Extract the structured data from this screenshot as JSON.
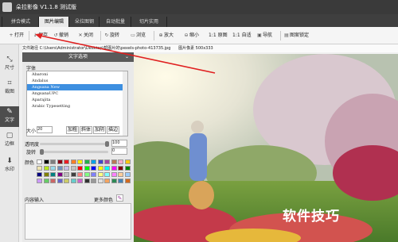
{
  "app": {
    "title": "朵拉影像 V1.1.8 测试版"
  },
  "tabs": [
    {
      "label": "拼合模式"
    },
    {
      "label": "图片编辑"
    },
    {
      "label": "朵拉图钢"
    },
    {
      "label": "自动批量"
    },
    {
      "label": "切片实用"
    }
  ],
  "toolbar": {
    "open": "打开",
    "save": "保存",
    "redo": "撤销",
    "close": "关闭",
    "rotate": "旋转",
    "browse": "浏览",
    "zoom_in": "放大",
    "zoom_out": "缩小",
    "zoom_1to1": "1:1 原图",
    "zoom_fit": "1:1 自适",
    "nav": "导航",
    "fix": "图案锁定"
  },
  "pathbar": {
    "path": "文件路径 C:\\Users\\Administrator\\Desktop\\帮图片的\\pexels-photo-413735.jpg",
    "size": "图片像素 500x333"
  },
  "sidebar": [
    {
      "label": "尺寸",
      "icon": "resize-icon"
    },
    {
      "label": "裁图",
      "icon": "crop-icon"
    },
    {
      "label": "文字",
      "icon": "text-icon"
    },
    {
      "label": "边框",
      "icon": "border-icon"
    },
    {
      "label": "水印",
      "icon": "watermark-icon"
    }
  ],
  "panel": {
    "header": "文字选项",
    "font_label": "字体",
    "fonts": [
      "Abaroni",
      "Andalus",
      "Angsana New",
      "AngsanaUPC",
      "Aparajita",
      "Arabic Typesetting"
    ],
    "selected_font_index": 2,
    "size_label": "大小",
    "size_value": "20",
    "btn_bold": "加粗",
    "btn_italic": "斜体",
    "btn_shadow": "加阴",
    "btn_stroke": "描边",
    "opacity_label": "透明度",
    "opacity_value": "100",
    "rotate_label": "旋转",
    "rotate_value": "0",
    "color_label": "颜色",
    "content_label": "内容输入",
    "more_colors": "更多颜色",
    "accent": "#3d8fe0"
  },
  "swatch_colors": [
    "#ffffff",
    "#000000",
    "#7f7f7f",
    "#880015",
    "#ed1c24",
    "#ff7f27",
    "#fff200",
    "#22b14c",
    "#00a2e8",
    "#3f48cc",
    "#a349a4",
    "#b97a57",
    "#ffaec9",
    "#ffc90e",
    "#efe4b0",
    "#b5e61d",
    "#99d9ea",
    "#7092be",
    "#c8bfe7",
    "#c3c3c3",
    "#ff0000",
    "#00ff00",
    "#0000ff",
    "#ffff00",
    "#00ffff",
    "#ff00ff",
    "#800000",
    "#008000",
    "#000080",
    "#808000",
    "#008080",
    "#800080",
    "#c0c0c0",
    "#404040",
    "#ff8080",
    "#80ff80",
    "#8080ff",
    "#ffff80",
    "#80ffff",
    "#ff80ff",
    "#ffcc99",
    "#99ccff",
    "#cc99ff",
    "#66cc66",
    "#cc6666",
    "#6666cc",
    "#cccc66",
    "#66cccc",
    "#cc66cc",
    "#333333",
    "#999999",
    "#e0e0e0",
    "#f4a460",
    "#2e8b57",
    "#4682b4",
    "#d2691e"
  ],
  "watermark": "软件技巧"
}
